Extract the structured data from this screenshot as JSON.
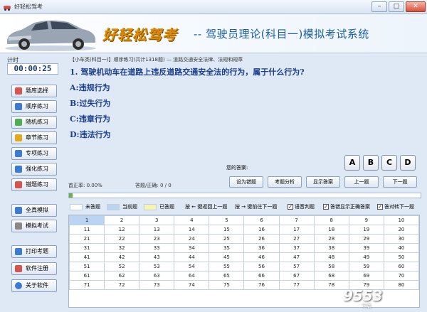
{
  "window": {
    "title": "好轻松驾考"
  },
  "banner": {
    "brand": "好轻松驾考",
    "subtitle": "-- 驾驶员理论(科目一)模拟考试系统"
  },
  "timer": {
    "label": "计时",
    "value": "00:00:25"
  },
  "sidebar": {
    "items": [
      {
        "label": "题库选择",
        "icon": "grid-icon",
        "color": "#d9534f"
      },
      {
        "label": "顺序练习",
        "icon": "checklist-icon",
        "color": "#3a7bd5"
      },
      {
        "label": "随机练习",
        "icon": "shuffle-icon",
        "color": "#4caf50"
      },
      {
        "label": "章节练习",
        "icon": "book-icon",
        "color": "#e6a817"
      },
      {
        "label": "专项练习",
        "icon": "checkbox-icon",
        "color": "#3a7bd5"
      },
      {
        "label": "强化练习",
        "icon": "chart-icon",
        "color": "#3a7bd5"
      },
      {
        "label": "错题练习",
        "icon": "flag-icon",
        "color": "#d9534f"
      },
      {
        "label": "全真模拟",
        "icon": "monitor-icon",
        "color": "#3a7bd5"
      },
      {
        "label": "模拟考试",
        "icon": "document-icon",
        "color": "#888888"
      },
      {
        "label": "打印考题",
        "icon": "printer-icon",
        "color": "#3a7bd5"
      },
      {
        "label": "软件注册",
        "icon": "wrench-icon",
        "color": "#d9534f"
      },
      {
        "label": "关于软件",
        "icon": "info-icon",
        "color": "#3a7bd5"
      }
    ]
  },
  "main": {
    "breadcrumb": "【小车类(科目一)】顺序练习(共计1318题) — 道路交通安全法律、法规和规章",
    "question": "1. 驾驶机动车在道路上违反道路交通安全法的行为，属于什么行为?",
    "options": [
      "A:违规行为",
      "B:过失行为",
      "C:违章行为",
      "D:违法行为"
    ],
    "answer_label": "您的答案:",
    "answer_buttons": [
      "A",
      "B",
      "C",
      "D"
    ],
    "accuracy": "首正率: 0.00%",
    "question_counter": "答题/正确: 0 / 0",
    "actions": [
      "设为错题",
      "考题分析",
      "显示答案",
      "上一题",
      "下一题"
    ],
    "progress": 0.01
  },
  "legend": {
    "unanswered": "未答题",
    "current": "当前题",
    "answered": "已答题",
    "prev_hint": "按 ← 键返回上一题",
    "next_hint": "按 → 键前往下一题",
    "voice": "语音判题",
    "show_correct": "答错显示正确答案",
    "auto_next": "答对转下一题",
    "colors": {
      "unanswered": "#ffffff",
      "current": "#b9d5f2",
      "answered": "#f7f3b0"
    }
  },
  "grid": {
    "rows": [
      [
        "1",
        "2",
        "3",
        "4",
        "5",
        "6",
        "7",
        "8",
        "9",
        "10"
      ],
      [
        "11",
        "12",
        "13",
        "14",
        "15",
        "16",
        "17",
        "18",
        "19",
        "20"
      ],
      [
        "21",
        "22",
        "23",
        "24",
        "25",
        "26",
        "27",
        "28",
        "29",
        "30"
      ],
      [
        "31",
        "32",
        "33",
        "34",
        "35",
        "36",
        "37",
        "38",
        "39",
        "40"
      ],
      [
        "41",
        "42",
        "43",
        "44",
        "45",
        "46",
        "47",
        "48",
        "49",
        "50"
      ],
      [
        "51",
        "52",
        "53",
        "54",
        "55",
        "56",
        "57",
        "58",
        "59",
        "60"
      ],
      [
        "61",
        "62",
        "63",
        "64",
        "65",
        "66",
        "67",
        "68",
        "69",
        "70"
      ],
      [
        "71",
        "72",
        "73",
        "74",
        "75",
        "76",
        "77",
        "78",
        "79",
        "80"
      ]
    ]
  },
  "watermark": {
    "text": "9553",
    "sub": "下载"
  }
}
